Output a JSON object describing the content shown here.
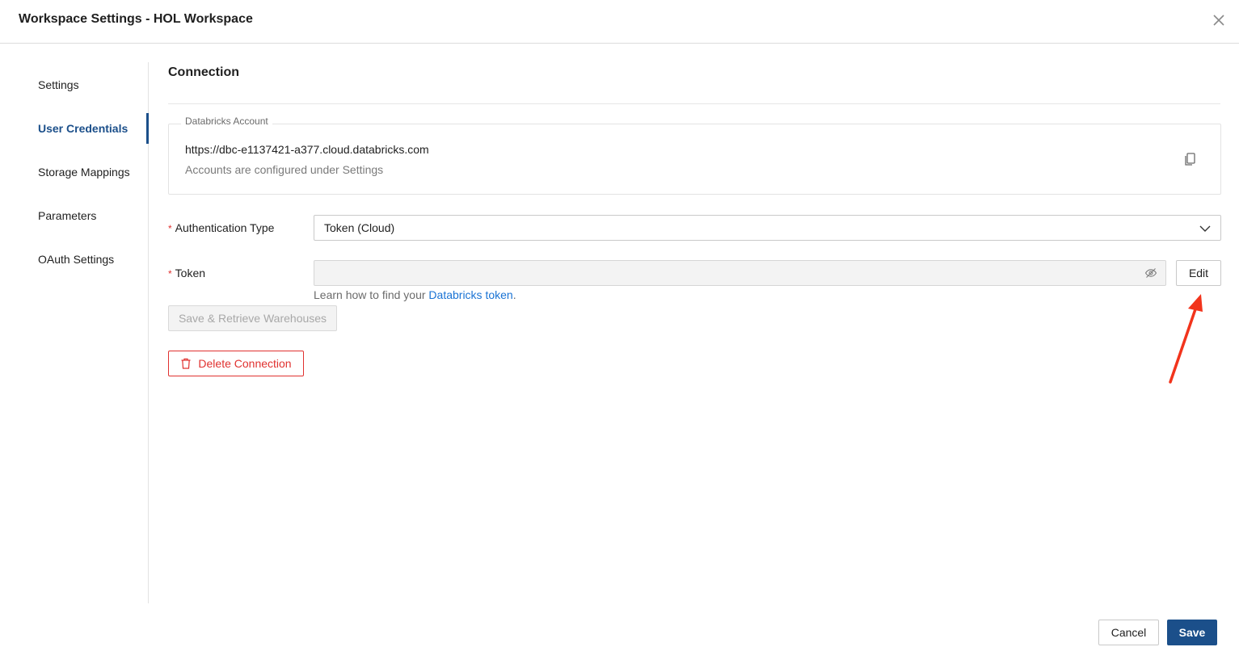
{
  "window": {
    "title": "Workspace Settings - HOL Workspace"
  },
  "sidebar": {
    "items": [
      {
        "label": "Settings",
        "active": false
      },
      {
        "label": "User Credentials",
        "active": true
      },
      {
        "label": "Storage Mappings",
        "active": false
      },
      {
        "label": "Parameters",
        "active": false
      },
      {
        "label": "OAuth Settings",
        "active": false
      }
    ]
  },
  "connection": {
    "section_title": "Connection",
    "account": {
      "legend": "Databricks Account",
      "url": "https://dbc-e1137421-a377.cloud.databricks.com",
      "hint": "Accounts are configured under Settings"
    },
    "auth_type": {
      "label": "Authentication Type",
      "value": "Token (Cloud)",
      "required_mark": "*"
    },
    "token": {
      "label": "Token",
      "required_mark": "*",
      "value": "",
      "edit_label": "Edit",
      "help_prefix": "Learn how to find your ",
      "help_link": "Databricks token",
      "help_suffix": "."
    },
    "retrieve_label": "Save & Retrieve Warehouses",
    "delete_label": "Delete Connection"
  },
  "footer": {
    "cancel_label": "Cancel",
    "save_label": "Save"
  },
  "colors": {
    "accent": "#1b4f8a",
    "danger": "#e0312f",
    "link": "#1a73d4",
    "annotation_arrow": "#f2341c"
  },
  "icons": {
    "close": "close-icon",
    "copy": "copy-icon",
    "chevron": "chevron-down-icon",
    "eye": "eye-slash-icon",
    "trash": "trash-icon"
  }
}
